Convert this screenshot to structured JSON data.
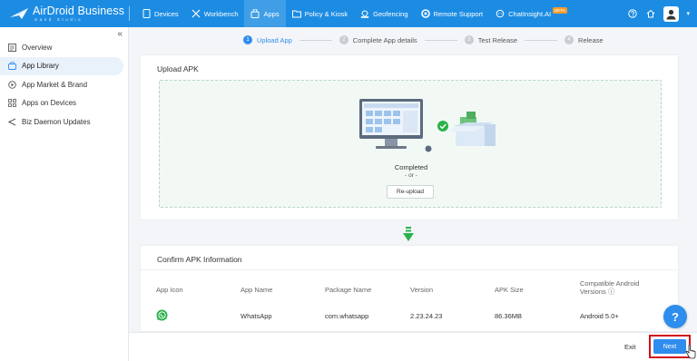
{
  "app": {
    "brand": "AirDroid Business",
    "brand_sub": "Sand Studio"
  },
  "nav": [
    {
      "label": "Devices",
      "icon": "tablet-icon"
    },
    {
      "label": "Workbench",
      "icon": "tools-icon"
    },
    {
      "label": "Apps",
      "icon": "bag-icon",
      "active": true
    },
    {
      "label": "Policy & Kiosk",
      "icon": "folder-icon"
    },
    {
      "label": "Geofencing",
      "icon": "location-icon"
    },
    {
      "label": "Remote Support",
      "icon": "support-icon"
    },
    {
      "label": "ChatInsight.AI",
      "icon": "chat-icon",
      "badge": "BETA"
    }
  ],
  "sidebar": {
    "items": [
      {
        "label": "Overview",
        "icon": "list-icon"
      },
      {
        "label": "App Library",
        "icon": "bag-icon",
        "active": true
      },
      {
        "label": "App Market & Brand",
        "icon": "store-icon"
      },
      {
        "label": "Apps on Devices",
        "icon": "grid-icon"
      },
      {
        "label": "Biz Daemon Updates",
        "icon": "share-icon"
      }
    ]
  },
  "steps": [
    {
      "num": "1",
      "label": "Upload App",
      "active": true
    },
    {
      "num": "2",
      "label": "Complete App details"
    },
    {
      "num": "3",
      "label": "Test Release"
    },
    {
      "num": "4",
      "label": "Release"
    }
  ],
  "upload": {
    "title": "Upload APK",
    "status": "Completed",
    "or": "- or -",
    "reupload": "Re-upload"
  },
  "confirm": {
    "title": "Confirm APK Information",
    "headers": [
      "App Icon",
      "App Name",
      "Package Name",
      "Version",
      "APK Size",
      "Compatible Android Versions ⓘ"
    ],
    "row": {
      "icon": "whatsapp-icon",
      "app_name": "WhatsApp",
      "package": "com.whatsapp",
      "version": "2.23.24.23",
      "size": "86.36MB",
      "compat": "Android 5.0+"
    }
  },
  "footer": {
    "exit": "Exit",
    "next": "Next"
  },
  "help": "?",
  "colors": {
    "topbar": "#1c8ce3",
    "accent": "#2f8ded",
    "success": "#2ab24a",
    "highlight": "#d0101b"
  }
}
